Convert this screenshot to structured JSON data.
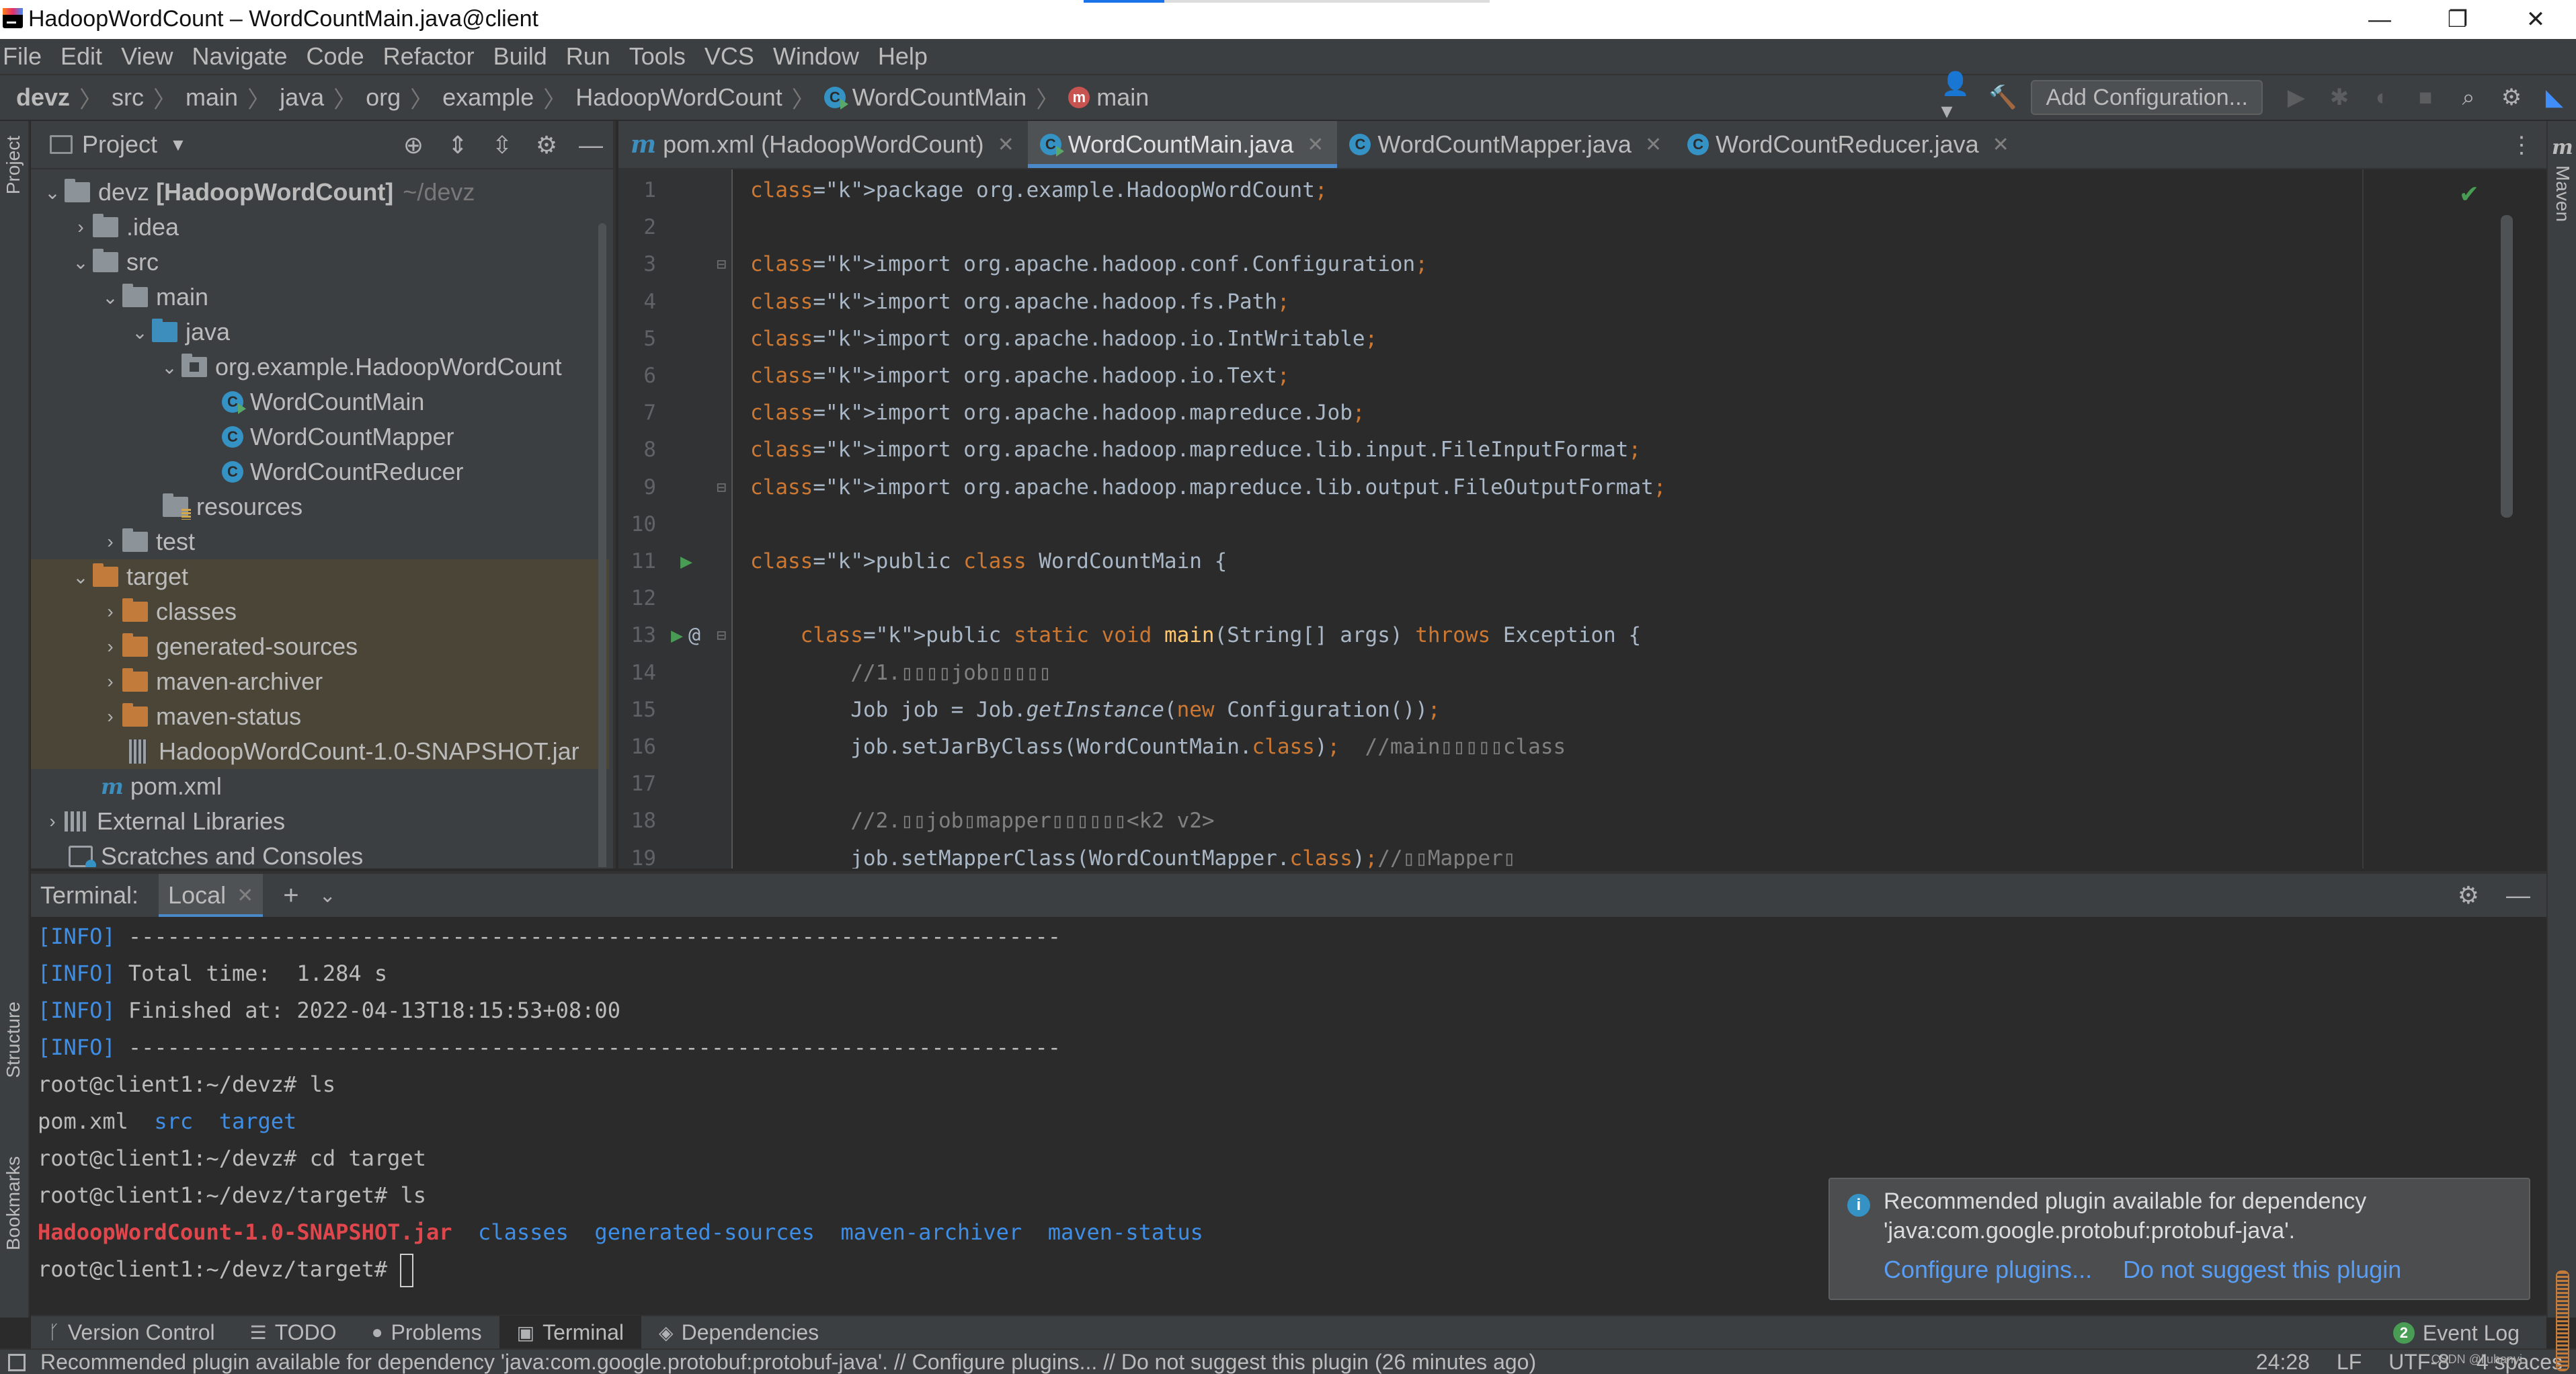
{
  "window": {
    "title": "HadoopWordCount – WordCountMain.java@client",
    "minimize": "—",
    "restore": "❐",
    "close": "✕"
  },
  "menu": [
    "File",
    "Edit",
    "View",
    "Navigate",
    "Code",
    "Refactor",
    "Build",
    "Run",
    "Tools",
    "VCS",
    "Window",
    "Help"
  ],
  "breadcrumb": [
    "devz",
    "src",
    "main",
    "java",
    "org",
    "example",
    "HadoopWordCount",
    "WordCountMain",
    "main"
  ],
  "toolbar": {
    "add_configuration": "Add Configuration..."
  },
  "left_strip": {
    "project": "Project",
    "structure": "Structure",
    "bookmarks": "Bookmarks"
  },
  "right_strip": {
    "maven": "Maven",
    "maven_icon": "m"
  },
  "project_panel": {
    "title": "Project",
    "tree": {
      "root_name": "devz",
      "root_module": "[HadoopWordCount]",
      "root_path": "~/devz",
      "idea": ".idea",
      "src": "src",
      "main": "main",
      "java": "java",
      "package": "org.example.HadoopWordCount",
      "class_main": "WordCountMain",
      "class_mapper": "WordCountMapper",
      "class_reducer": "WordCountReducer",
      "resources": "resources",
      "test": "test",
      "target": "target",
      "classes": "classes",
      "generated_sources": "generated-sources",
      "maven_archiver": "maven-archiver",
      "maven_status": "maven-status",
      "jar": "HadoopWordCount-1.0-SNAPSHOT.jar",
      "pom": "pom.xml",
      "external_libraries": "External Libraries",
      "scratches": "Scratches and Consoles"
    }
  },
  "editor": {
    "tabs": [
      {
        "label": "pom.xml (HadoopWordCount)",
        "icon": "maven-icon"
      },
      {
        "label": "WordCountMain.java",
        "icon": "class-icon",
        "active": true
      },
      {
        "label": "WordCountMapper.java",
        "icon": "class-icon"
      },
      {
        "label": "WordCountReducer.java",
        "icon": "class-icon"
      }
    ],
    "lines": [
      {
        "n": "1",
        "t": "package org.example.HadoopWordCount;"
      },
      {
        "n": "2",
        "t": ""
      },
      {
        "n": "3",
        "t": "import org.apache.hadoop.conf.Configuration;"
      },
      {
        "n": "4",
        "t": "import org.apache.hadoop.fs.Path;"
      },
      {
        "n": "5",
        "t": "import org.apache.hadoop.io.IntWritable;"
      },
      {
        "n": "6",
        "t": "import org.apache.hadoop.io.Text;"
      },
      {
        "n": "7",
        "t": "import org.apache.hadoop.mapreduce.Job;"
      },
      {
        "n": "8",
        "t": "import org.apache.hadoop.mapreduce.lib.input.FileInputFormat;"
      },
      {
        "n": "9",
        "t": "import org.apache.hadoop.mapreduce.lib.output.FileOutputFormat;"
      },
      {
        "n": "10",
        "t": ""
      },
      {
        "n": "11",
        "t": "public class WordCountMain {"
      },
      {
        "n": "12",
        "t": ""
      },
      {
        "n": "13",
        "t": "    public static void main(String[] args) throws Exception {"
      },
      {
        "n": "14",
        "t": "        //1.▯▯▯▯job▯▯▯▯▯"
      },
      {
        "n": "15",
        "t": "        Job job = Job.getInstance(new Configuration());"
      },
      {
        "n": "16",
        "t": "        job.setJarByClass(WordCountMain.class);  //main▯▯▯▯▯class"
      },
      {
        "n": "17",
        "t": ""
      },
      {
        "n": "18",
        "t": "        //2.▯▯job▯mapper▯▯▯▯▯▯<k2 v2>"
      },
      {
        "n": "19",
        "t": "        job.setMapperClass(WordCountMapper.class);//▯▯Mapper▯"
      }
    ]
  },
  "terminal": {
    "label": "Terminal:",
    "tab": "Local",
    "lines": [
      "[INFO] ------------------------------------------------------------------------",
      "[INFO] Total time:  1.284 s",
      "[INFO] Finished at: 2022-04-13T18:15:53+08:00",
      "[INFO] ------------------------------------------------------------------------",
      "root@client1:~/devz# ls",
      "pom.xml  src  target",
      "root@client1:~/devz# cd target",
      "root@client1:~/devz/target# ls",
      "HadoopWordCount-1.0-SNAPSHOT.jar  classes  generated-sources  maven-archiver  maven-status",
      "root@client1:~/devz/target# "
    ]
  },
  "notification": {
    "line1": "Recommended plugin available for dependency",
    "line2": "'java:com.google.protobuf:protobuf-java'.",
    "link_configure": "Configure plugins...",
    "link_dismiss": "Do not suggest this plugin"
  },
  "bottom_tabs": [
    "Version Control",
    "TODO",
    "Problems",
    "Terminal",
    "Dependencies"
  ],
  "event_log": {
    "label": "Event Log",
    "count": "2"
  },
  "status_bar": {
    "message": "Recommended plugin available for dependency 'java:com.google.protobuf:protobuf-java'. // Configure plugins... // Do not suggest this plugin (26 minutes ago)",
    "position": "24:28",
    "line_sep": "LF",
    "encoding": "UTF-8",
    "indent": "4 spaces"
  },
  "watermark": "CSDN @liuhanyi"
}
